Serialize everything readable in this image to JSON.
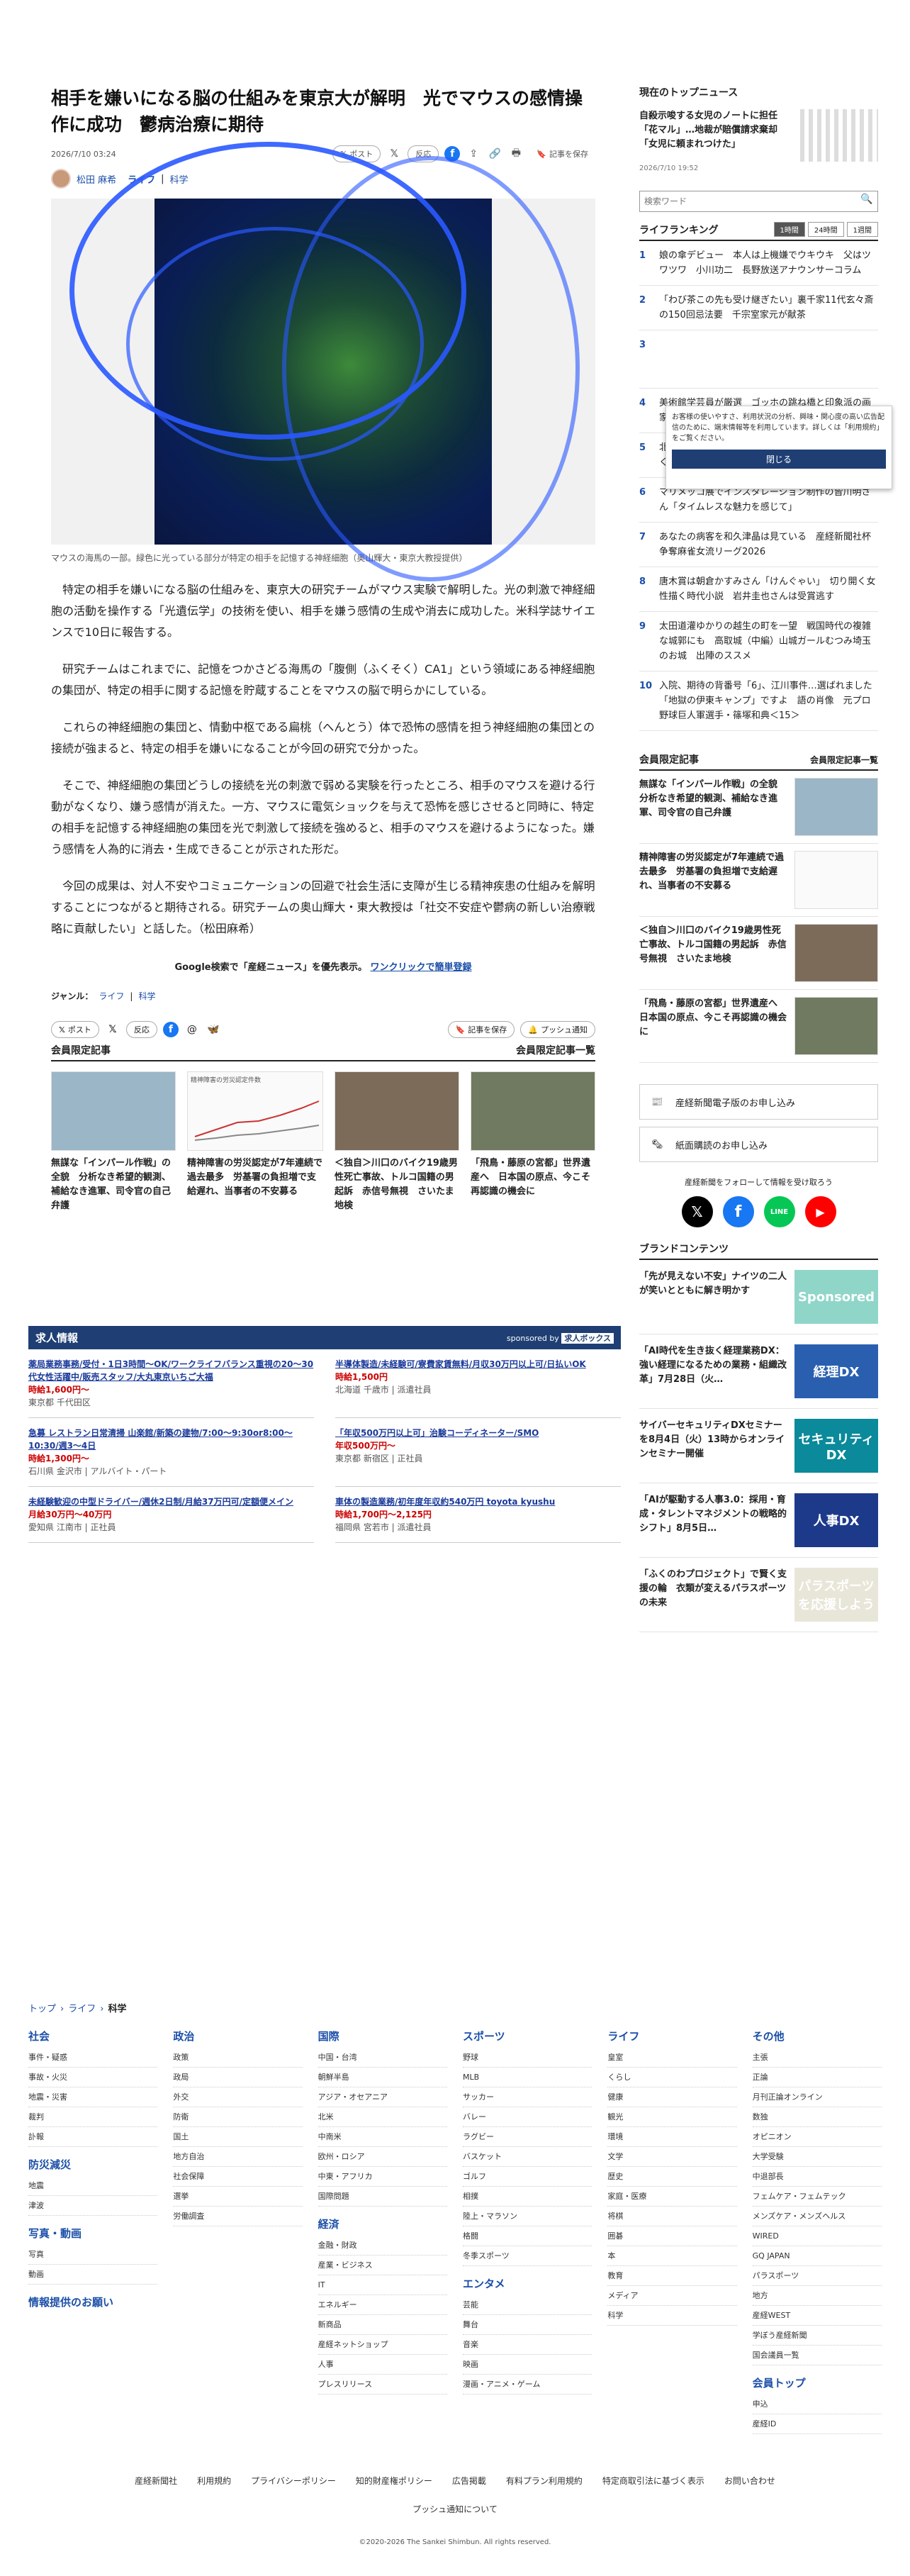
{
  "article": {
    "title": "相手を嫌いになる脳の仕組みを東京大が解明　光でマウスの感情操作に成功　鬱病治療に期待",
    "date": "2026/7/10 03:24",
    "share_post": "ポスト",
    "share_react": "反応",
    "save_label": "記事を保存",
    "author": "松田 麻希",
    "category_1": "ライフ",
    "category_2": "科学",
    "caption": "マウスの海馬の一部。緑色に光っている部分が特定の相手を記憶する神経細胞（奥山輝大・東京大教授提供）",
    "paragraphs": [
      "特定の相手を嫌いになる脳の仕組みを、東京大の研究チームがマウス実験で解明した。光の刺激で神経細胞の活動を操作する「光遺伝学」の技術を使い、相手を嫌う感情の生成や消去に成功した。米科学誌サイエンスで10日に報告する。",
      "研究チームはこれまでに、記憶をつかさどる海馬の「腹側（ふくそく）CA1」という領域にある神経細胞の集団が、特定の相手に関する記憶を貯蔵することをマウスの脳で明らかにしている。",
      "これらの神経細胞の集団と、情動中枢である扁桃（へんとう）体で恐怖の感情を担う神経細胞の集団との接続が強まると、特定の相手を嫌いになることが今回の研究で分かった。",
      "そこで、神経細胞の集団どうしの接続を光の刺激で弱める実験を行ったところ、相手のマウスを避ける行動がなくなり、嫌う感情が消えた。一方、マウスに電気ショックを与えて恐怖を感じさせると同時に、特定の相手を記憶する神経細胞の集団を光で刺激して接続を強めると、相手のマウスを避けるようになった。嫌う感情を人為的に消去・生成できることが示された形だ。",
      "今回の成果は、対人不安やコミュニケーションの回避で社会生活に支障が生じる精神疾患の仕組みを解明することにつながると期待される。研究チームの奥山輝大・東大教授は「社交不安症や鬱病の新しい治療戦略に貢献したい」と話した。（松田麻希）"
    ],
    "google_text": "Google検索で「産経ニュース」を優先表示。",
    "google_link": "ワンクリックで簡単登録",
    "genre_label": "ジャンル：",
    "push_label": "プッシュ通知"
  },
  "members": {
    "title": "会員限定記事",
    "more": "会員限定記事一覧",
    "items": [
      "無謀な「インパール作戦」の全貌　分析なき希望的観測、補給なき進軍、司令官の自己弁護",
      "精神障害の労災認定が7年連続で過去最多　労基署の負担増で支給遅れ、当事者の不安募る",
      "＜独自＞川口のバイク19歳男性死亡事故、トルコ国籍の男起訴　赤信号無視　さいたま地検",
      "「飛鳥・藤原の宮都」世界遺産へ　日本国の原点、今こそ再認識の機会に"
    ],
    "chart_title": "精神障害の労災認定件数",
    "chart_note": "精神障害の労災認定件数と申請件数の推移"
  },
  "jobs": {
    "title": "求人情報",
    "sponsor": "sponsored by",
    "sponsor_brand": "求人ボックス",
    "items": [
      {
        "t": "薬局業務事務/受付・1日3時間〜OK/ワークライフバランス重視の20〜30代女性活躍中/販売スタッフ/大丸東京いちご大福",
        "pay": "時給1,600円〜",
        "loc": "東京都 千代田区"
      },
      {
        "t": "半導体製造/未経験可/寮費家賃無料/月収30万円以上可/日払いOK",
        "pay": "時給1,500円",
        "loc": "北海道 千歳市 | 派遣社員"
      },
      {
        "t": "急募 レストラン日常清掃 山楽館/新築の建物/7:00〜9:30or8:00〜10:30/週3〜4日",
        "pay": "時給1,300円〜",
        "loc": "石川県 金沢市 | アルバイト・パート"
      },
      {
        "t": "「年収500万円以上可」治験コーディネーター/SMO",
        "pay": "年収500万円〜",
        "loc": "東京都 新宿区 | 正社員"
      },
      {
        "t": "未経験歓迎の中型ドライバー/週休2日制/月給37万円可/定額便メイン",
        "pay": "月給30万円〜40万円",
        "loc": "愛知県 江南市 | 正社員"
      },
      {
        "t": "車体の製造業務/初年度年収約540万円 toyota kyushu",
        "pay": "時給1,700円〜2,125円",
        "loc": "福岡県 宮若市 | 派遣社員"
      }
    ]
  },
  "side": {
    "top_title": "現在のトップニュース",
    "top_headline": "自殺示唆する女児のノートに担任「花マル」…地裁が賠償請求棄却「女児に頼まれつけた」",
    "top_date": "2026/7/10 19:52",
    "search_placeholder": "検索ワード",
    "ranking_title": "ライフランキング",
    "tabs": [
      "1時間",
      "24時間",
      "1週間"
    ],
    "ranking": [
      "娘の傘デビュー　本人は上機嫌でウキウキ　父はツワツワ　小川功二　長野放送アナウンサーコラム",
      "「わび茶この先も受け継ぎたい」裏千家11代玄々斎の150回忌法要　千宗室家元が献茶",
      "",
      "美術館学芸員が厳選　ゴッホの跳ね橋と印象派の画家たち　モネ「霧の中の国会議事堂」など作品紹介",
      "北陸新幹線「桂川案」27年度着工に「「えっ」と驚く」京都市長が慎重な検討訴える",
      "マリメッコ展でインスタレーション制作の皆川明さん「タイムレスな魅力を感じて」",
      "あなたの病客を和久津晶は見ている　産経新聞社杯争奪麻雀女流リーグ2026",
      "唐木賞は朝倉かすみさん「けんぐゃい」　切り開く女性描く時代小説　岩井圭也さんは受賞逃す",
      "太田道灌ゆかりの越生の町を一望　戦国時代の複雑な城郭にも　高取城（中編）山城ガールむつみ埼玉のお城　出陣のススメ",
      "入院、期待の背番号「6」、江川事件…選ばれました「地獄の伊東キャンプ」ですよ　語の肖像　元プロ野球巨人軍選手・篠塚和典＜15＞"
    ],
    "cookie_text": "お客様の使いやすさ、利用状況の分析、興味・関心度の高い広告配信のために、端末情報等を利用しています。詳しくは「利用規約」をご覧ください。",
    "cookie_close": "閉じる",
    "members_title": "会員限定記事",
    "members_more": "会員限定記事一覧",
    "members_items": [
      "無謀な「インパール作戦」の全貌　分析なき希望的観測、補給なき進軍、司令官の自己弁護",
      "精神障害の労災認定が7年連続で過去最多　労基署の負担増で支給遅れ、当事者の不安募る",
      "＜独自＞川口のバイク19歳男性死亡事故、トルコ国籍の男起訴　赤信号無視　さいたま地検",
      "「飛鳥・藤原の宮都」世界遺産へ　日本国の原点、今こそ再認識の機会に"
    ],
    "paper": "産経新聞電子版のお申し込み",
    "paper2": "紙面購読のお申し込み",
    "follow": "産経新聞をフォローして情報を受け取ろう",
    "brand_title": "ブランドコンテンツ",
    "brand": [
      {
        "t": "「先が見えない不安」ナイツの二人が笑いとともに解き明かす",
        "tag": "Sponsored"
      },
      {
        "t": "「AI時代を生き抜く経理業務DX：強い経理になるための業務・組織改革」7月28日（火…",
        "tag": "経理DX"
      },
      {
        "t": "サイバーセキュリティDXセミナーを8月4日（火）13時からオンラインセミナー開催",
        "tag": "セキュリティDX"
      },
      {
        "t": "「AIが駆動する人事3.0：採用・育成・タレントマネジメントの戦略的シフト」8月5日…",
        "tag": "人事DX"
      },
      {
        "t": "「ふくのわプロジェクト」で賢く支援の輪　衣類が変えるパラスポーツの未来",
        "tag": "パラスポーツを応援しよう"
      }
    ]
  },
  "footer": {
    "breadcrumb": [
      "トップ",
      "ライフ",
      "科学"
    ],
    "cols": [
      {
        "h": "社会",
        "items": [
          "事件・疑惑",
          "事故・火災",
          "地震・災害",
          "裁判",
          "訃報"
        ],
        "h2": "防災減災",
        "items2": [
          "地震",
          "津波"
        ],
        "h3": "写真・動画",
        "items3": [
          "写真",
          "動画"
        ],
        "h4": "情報提供のお願い"
      },
      {
        "h": "政治",
        "items": [
          "政策",
          "政局",
          "外交",
          "防衛",
          "国土",
          "地方自治",
          "社会保障",
          "選挙",
          "労働調査"
        ]
      },
      {
        "h": "国際",
        "items": [
          "中国・台湾",
          "朝鮮半島",
          "アジア・オセアニア",
          "北米",
          "中南米",
          "欧州・ロシア",
          "中東・アフリカ",
          "国際問題"
        ],
        "h2": "経済",
        "items2": [
          "金融・財政",
          "産業・ビジネス",
          "IT",
          "エネルギー",
          "新商品",
          "産経ネットショップ",
          "人事",
          "プレスリリース"
        ]
      },
      {
        "h": "スポーツ",
        "items": [
          "野球",
          "MLB",
          "サッカー",
          "バレー",
          "ラグビー",
          "バスケット",
          "ゴルフ",
          "相撲",
          "陸上・マラソン",
          "格闘",
          "冬季スポーツ"
        ],
        "h2": "エンタメ",
        "items2": [
          "芸能",
          "舞台",
          "音楽",
          "映画",
          "漫画・アニメ・ゲーム"
        ]
      },
      {
        "h": "ライフ",
        "items": [
          "皇室",
          "くらし",
          "健康",
          "観光",
          "環境",
          "文学",
          "歴史",
          "家庭・医療",
          "将棋",
          "囲碁",
          "本",
          "教育",
          "メディア",
          "科学"
        ]
      },
      {
        "h": "その他",
        "items": [
          "主張",
          "正論",
          "月刊正論オンライン",
          "数独",
          "オピニオン",
          "大学受験",
          "中退部長",
          "フェムケア・フェムテック",
          "メンズケア・メンズヘルス",
          "WIRED",
          "GQ JAPAN",
          "パラスポーツ",
          "地方",
          "産経WEST",
          "学ぼう産経新聞",
          "国会議員一覧"
        ],
        "h2": "会員トップ",
        "items2": [
          "申込",
          "産経ID"
        ]
      }
    ],
    "links": [
      "産経新聞社",
      "利用規約",
      "プライバシーポリシー",
      "知的財産権ポリシー",
      "広告掲載",
      "有料プラン利用規約",
      "特定商取引法に基づく表示",
      "お問い合わせ"
    ],
    "push": "プッシュ通知について",
    "copyright": "©2020-2026 The Sankei Shimbun. All rights reserved."
  }
}
